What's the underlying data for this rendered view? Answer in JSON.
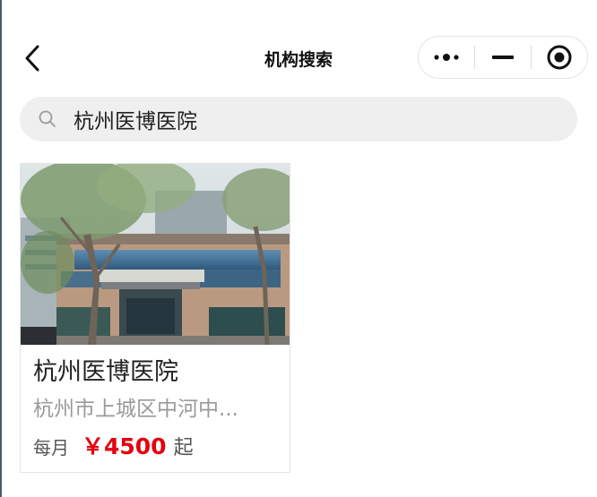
{
  "nav": {
    "title": "机构搜索",
    "back_icon": "chevron-left-icon",
    "capsule": {
      "more_icon": "more-dots-icon",
      "minimize_icon": "minimize-icon",
      "close_icon": "target-circle-icon"
    }
  },
  "search": {
    "value": "杭州医博医院",
    "icon": "search-icon"
  },
  "results": [
    {
      "name": "杭州医博医院",
      "address": "杭州市上城区中河中...",
      "price_prefix": "每月",
      "price": "￥4500",
      "price_suffix": "起",
      "photo": "hospital-building-photo"
    }
  ],
  "colors": {
    "price": "#e4000f",
    "search_bg": "#efefef",
    "muted_text": "#9a9a9a"
  }
}
